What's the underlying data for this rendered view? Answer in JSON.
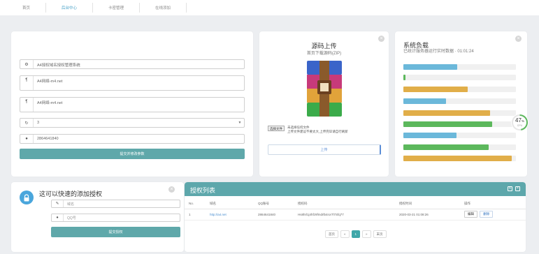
{
  "nav": {
    "items": [
      {
        "label": "首页",
        "active": false
      },
      {
        "label": "后台中心",
        "active": true
      },
      {
        "label": "卡密管理",
        "active": false
      },
      {
        "label": "在线添加",
        "active": false
      }
    ]
  },
  "form": {
    "system_name": "A4授权域名授权管理系统",
    "site_name_1": "A4网络-m4.net",
    "site_name_2": "A4网络-m4.net",
    "select_value": "3",
    "qq": "2864641840",
    "submit_label": "提交并修改参数"
  },
  "upload": {
    "title": "源码上传",
    "subtitle": "首页下载源码(ZIP)",
    "file_button": "选择文件",
    "file_status": "未选择任何文件",
    "note": "上传文件建议不要太大,上传完毕请自行刷新",
    "upload_button": "上传"
  },
  "load": {
    "title": "系统负载",
    "subtitle": "已统计服务器运行实时数据 · 01:01:24",
    "bars": [
      {
        "color": "#6bb8da",
        "fraction": 0.48
      },
      {
        "color": "#5cb85c",
        "fraction": 0.02
      },
      {
        "color": "#e1ae49",
        "fraction": 0.57
      },
      {
        "color": "#6bb8da",
        "fraction": 0.38
      },
      {
        "color": "#e1ae49",
        "fraction": 0.77
      },
      {
        "color": "#5cb85c",
        "fraction": 0.79
      },
      {
        "color": "#6bb8da",
        "fraction": 0.47
      },
      {
        "color": "#5cb85c",
        "fraction": 0.76
      },
      {
        "color": "#e1ae49",
        "fraction": 0.96
      }
    ],
    "gauge_value": "47",
    "gauge_unit": "%",
    "gauge_label": "CPU",
    "gauge_fraction": 0.47,
    "gauge_color": "#5cb85c"
  },
  "quick": {
    "title": "这可以快速的添加授权",
    "domain_placeholder": "域名",
    "qq_placeholder": "QQ号",
    "submit_label": "提交授权"
  },
  "list": {
    "title": "授权列表",
    "columns": [
      "No.",
      "域名",
      "QQ账号",
      "授权码",
      "授权时间",
      "操作"
    ],
    "rows": [
      {
        "no": "1",
        "domain": "http://a4.net",
        "qq": "2864641840",
        "code": "Hs8hrl1j4hfz9fmdrlb4ror7l7Sfq77",
        "time": "2020-03-21 01:08:26",
        "edit": "编辑",
        "delete": "删除"
      }
    ],
    "pager": {
      "first": "首页",
      "prev": "«",
      "current": "1",
      "next": "»",
      "last": "末页"
    }
  }
}
